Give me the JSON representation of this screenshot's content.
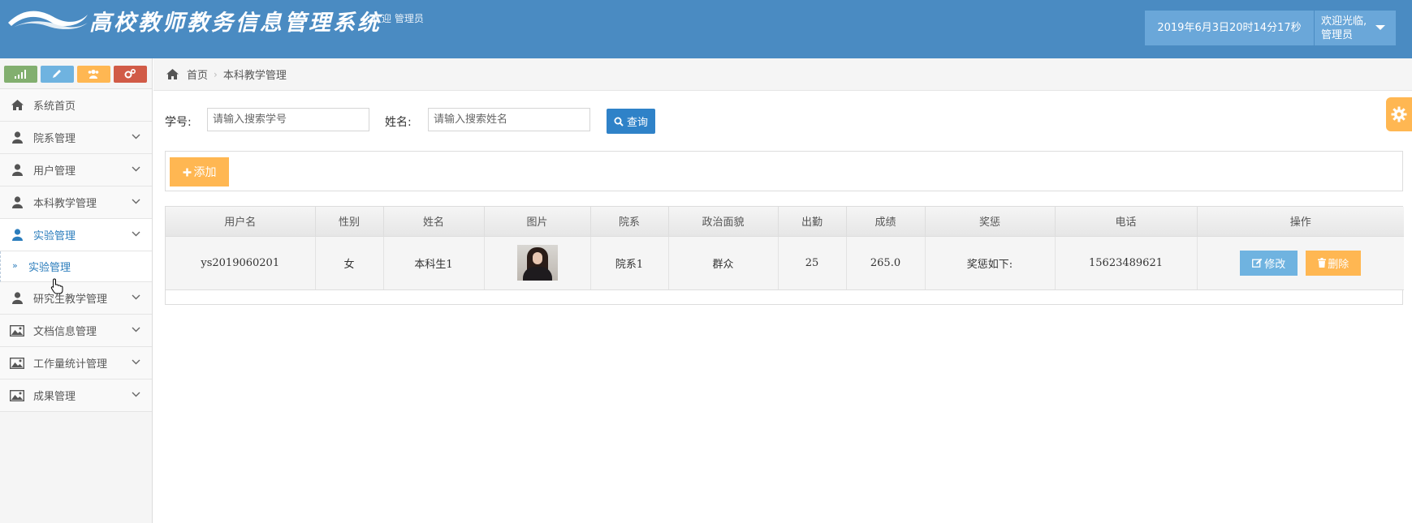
{
  "header": {
    "title": "高校教师教务信息管理系统",
    "welcome": "欢迎 管理员",
    "datetime": "2019年6月3日20时14分17秒",
    "user_line1": "欢迎光临,",
    "user_line2": "管理员",
    "color": "#4a8bc2"
  },
  "sidebar": {
    "shortcuts": [
      {
        "icon": "signal-icon",
        "color": "#82af6f"
      },
      {
        "icon": "pencil-icon",
        "color": "#6fb3e0"
      },
      {
        "icon": "users-icon",
        "color": "#ffb752"
      },
      {
        "icon": "cogs-icon",
        "color": "#d15b47"
      }
    ],
    "items": [
      {
        "label": "系统首页",
        "icon": "home-icon"
      },
      {
        "label": "院系管理",
        "icon": "user-icon"
      },
      {
        "label": "用户管理",
        "icon": "user-icon"
      },
      {
        "label": "本科教学管理",
        "icon": "user-icon"
      },
      {
        "label": "实验管理",
        "icon": "user-icon",
        "open": true
      },
      {
        "label": "研究生教学管理",
        "icon": "user-icon"
      },
      {
        "label": "文档信息管理",
        "icon": "picture-icon"
      },
      {
        "label": "工作量统计管理",
        "icon": "picture-icon"
      },
      {
        "label": "成果管理",
        "icon": "picture-icon"
      }
    ],
    "sub_item": "实验管理"
  },
  "breadcrumb": {
    "home": "首页",
    "current": "本科教学管理"
  },
  "search": {
    "id_label": "学号:",
    "id_placeholder": "请输入搜索学号",
    "name_label": "姓名:",
    "name_placeholder": "请输入搜索姓名",
    "button": "查询"
  },
  "toolbar": {
    "add_label": "添加"
  },
  "table": {
    "headers": [
      "用户名",
      "性别",
      "姓名",
      "图片",
      "院系",
      "政治面貌",
      "出勤",
      "成绩",
      "奖惩",
      "电话",
      "操作"
    ],
    "rows": [
      {
        "username": "ys2019060201",
        "gender": "女",
        "name": "本科生1",
        "dept": "院系1",
        "political": "群众",
        "attendance": "25",
        "score": "265.0",
        "reward": "奖惩如下:",
        "phone": "15623489621",
        "edit_label": "修改",
        "delete_label": "删除"
      }
    ]
  },
  "colors": {
    "accent_blue": "#2f82c8",
    "light_blue": "#6fb3e0",
    "orange": "#ffb752"
  }
}
